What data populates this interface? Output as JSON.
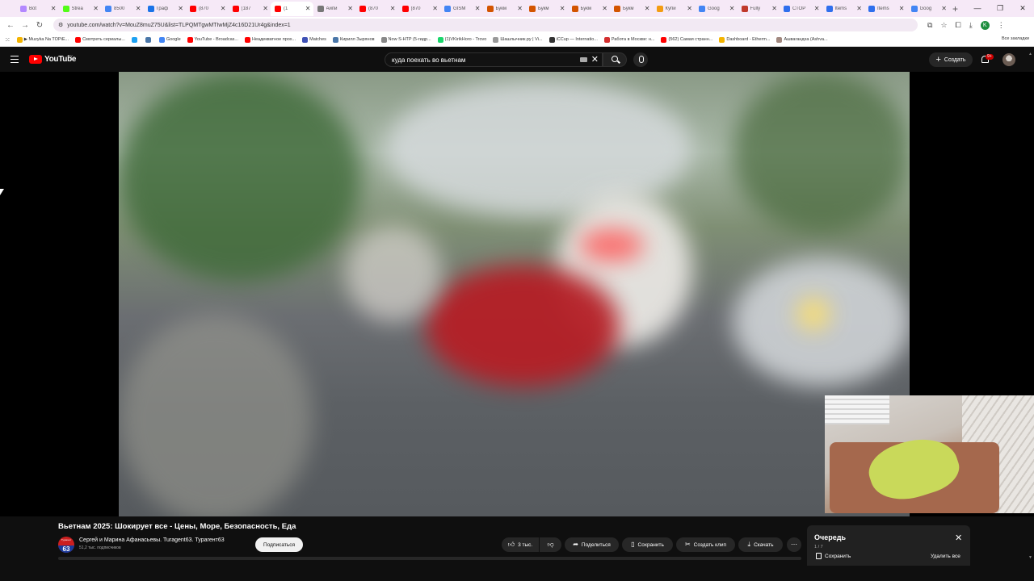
{
  "browser": {
    "tabs": [
      {
        "label": "Bot",
        "color": "#b388ff"
      },
      {
        "label": "Strea",
        "color": "#53fc18"
      },
      {
        "label": "8500",
        "color": "#4285f4"
      },
      {
        "label": "Граф",
        "color": "#1a73e8"
      },
      {
        "label": "(870",
        "color": "#ff0000"
      },
      {
        "label": "(187",
        "color": "#ff0000"
      },
      {
        "label": "(1",
        "color": "#ff0000"
      },
      {
        "label": "Айпи",
        "color": "#777777"
      },
      {
        "label": "(870",
        "color": "#ff0000"
      },
      {
        "label": "(870",
        "color": "#ff0000"
      },
      {
        "label": "GISM",
        "color": "#4285f4"
      },
      {
        "label": "Букм",
        "color": "#d35400"
      },
      {
        "label": "Букм",
        "color": "#d35400"
      },
      {
        "label": "Букм",
        "color": "#d35400"
      },
      {
        "label": "Букм",
        "color": "#d35400"
      },
      {
        "label": "Купи",
        "color": "#f39c12"
      },
      {
        "label": "Goog",
        "color": "#4285f4"
      },
      {
        "label": "Fully",
        "color": "#c0392b"
      },
      {
        "label": "СТОР",
        "color": "#2f6fed"
      },
      {
        "label": "Items",
        "color": "#2f6fed"
      },
      {
        "label": "Items",
        "color": "#2f6fed"
      },
      {
        "label": "Goog",
        "color": "#4285f4"
      }
    ],
    "active_tab_index": 6,
    "url": "youtube.com/watch?v=MouZ8muZ75U&list=TLPQMTgwMTIwMjZ4c16D21Ur4g&index=1",
    "profile_letter": "K",
    "bookmarks": [
      {
        "label": "▶ Muzyka Na TOPiE...",
        "color": "#f4b400"
      },
      {
        "label": "Смотреть сериалы...",
        "color": "#ff0000"
      },
      {
        "label": "",
        "color": "#1da1f2"
      },
      {
        "label": "",
        "color": "#4a76a8"
      },
      {
        "label": "Google",
        "color": "#4285f4"
      },
      {
        "label": "YouTube - Broadcas...",
        "color": "#ff0000"
      },
      {
        "label": "Неадекватное прох...",
        "color": "#ff0000"
      },
      {
        "label": "Matches",
        "color": "#3f51b5"
      },
      {
        "label": "Кирилл Зырянов",
        "color": "#4a76a8"
      },
      {
        "label": "Now S-HTP (5-гидр...",
        "color": "#888888"
      },
      {
        "label": "(1)VKirikHoro - Trovo",
        "color": "#19d66b"
      },
      {
        "label": "Шашлычник.ру | Vi...",
        "color": "#999999"
      },
      {
        "label": "iCCup — Internatio...",
        "color": "#333333"
      },
      {
        "label": "Работа в Москве: н...",
        "color": "#d32f2f"
      },
      {
        "label": "(562) Самая странн...",
        "color": "#ff0000"
      },
      {
        "label": "Dashboard - Etherm...",
        "color": "#f4b400"
      },
      {
        "label": "Ашвагандха (Ashva...",
        "color": "#a1887f"
      }
    ],
    "all_bookmarks_label": "Все закладки"
  },
  "youtube": {
    "logo_text": "YouTube",
    "country_code": "BY",
    "search_query": "куда поехать во вьетнам",
    "create_label": "Создать",
    "notif_badge": "9+"
  },
  "video": {
    "title": "Вьетнам 2025: Шокирует все - Цены, Море, Безопасность, Еда",
    "channel_name": "Сергей и Марина Афанасьевы. Turagent63. Турагент63",
    "subscribers": "51,2 тыс. подписчиков",
    "channel_avatar_top": "Турагент",
    "channel_avatar_num": "63",
    "subscribe_label": "Подписаться",
    "likes": "3 тыс.",
    "share_label": "Поделиться",
    "save_label": "Сохранить",
    "clip_label": "Создать клип",
    "download_label": "Скачать"
  },
  "queue": {
    "title": "Очередь",
    "position": "1 / 7",
    "save_label": "Сохранить",
    "clear_label": "Удалить все"
  }
}
